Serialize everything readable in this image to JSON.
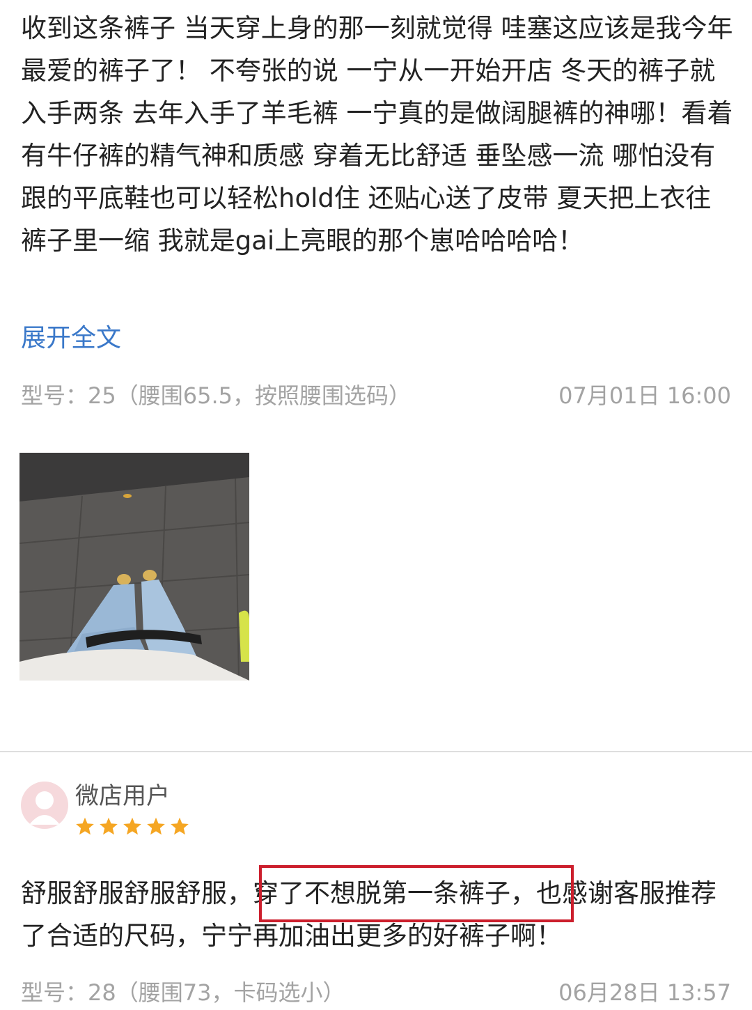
{
  "review1": {
    "text": "收到这条裤子 当天穿上身的那一刻就觉得 哇塞这应该是我今年最爱的裤子了！ 不夸张的说 一宁从一开始开店 冬天的裤子就入手两条 去年入手了羊毛裤 一宁真的是做阔腿裤的神哪！看着有牛仔裤的精气神和质感 穿着无比舒适 垂坠感一流 哪怕没有跟的平底鞋也可以轻松hold住 还贴心送了皮带 夏天把上衣往裤子里一缩 我就是gai上亮眼的那个崽哈哈哈哈！",
    "expand_label": "展开全文",
    "model_spec": "型号：25（腰围65.5，按照腰围选码）",
    "timestamp": "07月01日 16:00"
  },
  "review2": {
    "username": "微店用户",
    "rating": 5,
    "text_before": "舒服舒服舒服舒服，",
    "text_highlight": "穿了不想脱第一条裤子，",
    "text_after": "也感谢客服推荐了合适的尺码，宁宁再加油出更多的好裤子啊！",
    "model_spec": "型号：28（腰围73，卡码选小）",
    "timestamp": "06月28日 13:57"
  },
  "colors": {
    "link": "#3a78c9",
    "meta": "#a3a3a3",
    "star": "#f5a623",
    "highlight_border": "#cc1f2d",
    "avatar_bg": "#f6d9dc"
  }
}
